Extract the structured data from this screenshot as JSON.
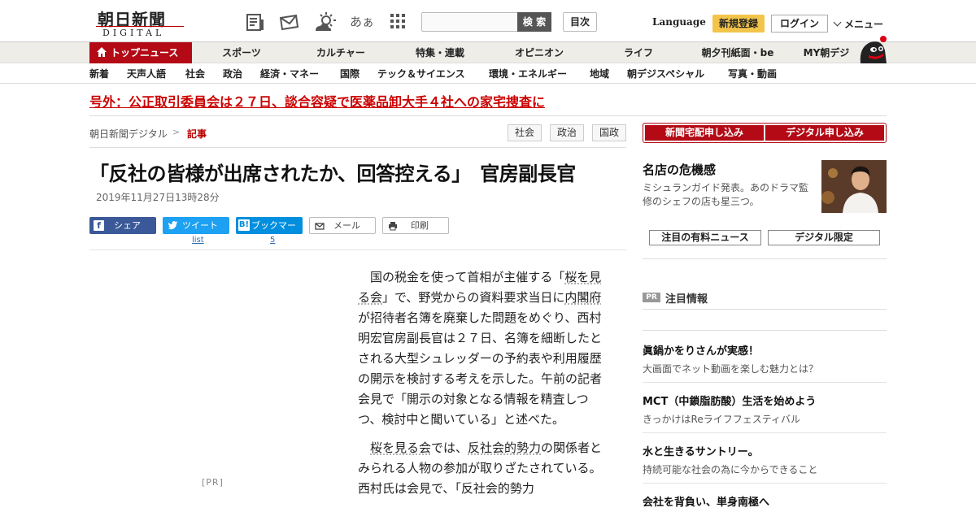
{
  "header": {
    "logo_jp": "朝日新聞",
    "logo_en": "DIGITAL",
    "search_placeholder": "",
    "search_button": "検 索",
    "contents_button": "目次",
    "language": "Language",
    "register": "新規登録",
    "login": "ログイン",
    "menu": "メニュー",
    "icons": [
      "paper-icon",
      "mail-icon",
      "weather-icon",
      "font-size-icon",
      "grid-icon"
    ],
    "font_size_glyph": "あぁ"
  },
  "nav_primary": {
    "top_news": "トップニュース",
    "items": [
      "スポーツ",
      "カルチャー",
      "特集・連載",
      "オピニオン",
      "ライフ",
      "朝夕刊紙面・be",
      "MY朝デジ"
    ]
  },
  "nav_secondary": {
    "items": [
      "新着",
      "天声人語",
      "社会",
      "政治",
      "経済・マネー",
      "国際",
      "テック＆サイエンス",
      "環境・エネルギー",
      "地域",
      "朝デジスペシャル",
      "写真・動画"
    ]
  },
  "breaking": "号外：公正取引委員会は２７日、談合容疑で医薬品卸大手４社への家宅捜査に",
  "breadcrumb": {
    "home": "朝日新聞デジタル",
    "separator": ">",
    "current": "記事"
  },
  "tags": [
    "社会",
    "政治",
    "国政"
  ],
  "article": {
    "headline": "「反社の皆様が出席されたか、回答控える」　官房副長官",
    "date": "2019年11月27日13時28分",
    "share": {
      "facebook": "シェア",
      "twitter": "ツイート",
      "twitter_sub": "list",
      "hatena": "ブックマーク",
      "hatena_sub": "5",
      "mail": "メール",
      "print": "印刷"
    },
    "pr_label": "[PR]",
    "p1": {
      "pre": "国の税金を使って首相が主催する「",
      "kw1": "桜を見る会",
      "mid1": "」で、野党からの資料要求当日に",
      "kw2": "内閣府",
      "rest": "が招待者名簿を廃棄した問題をめぐり、西村明宏官房副長官は２７日、名簿を細断したとされる大型シュレッダーの予約表や利用履歴の開示を検討する考えを示した。午前の記者会見で「開示の対象となる情報を精査しつつ、検討中と聞いている」と述べた。"
    },
    "p2": {
      "kw1": "桜を見る会",
      "mid1": "では、",
      "kw2": "反社会的勢力",
      "rest": "の関係者とみられる人物の参加が取りざたされている。西村氏は会見で、「反社会的勢力"
    }
  },
  "sidebar": {
    "subscribe_paper": "新聞宅配申し込み",
    "subscribe_digital": "デジタル申し込み",
    "promo_title": "名店の危機感",
    "promo_text": "ミシュランガイド発表。あのドラマ監修のシェフの店も星三つ。",
    "tab_paid": "注目の有料ニュース",
    "tab_digital": "デジタル限定",
    "pr_badge": "PR",
    "notice_title": "注目情報",
    "ads": [
      {
        "title": "眞鍋かをりさんが実感！",
        "desc": "大画面でネット動画を楽しむ魅力とは？"
      },
      {
        "title": "MCT（中鎖脂肪酸）生活を始めよう",
        "desc": "きっかけはReライフフェスティバル"
      },
      {
        "title": "水と生きるサントリー。",
        "desc": "持続可能な社会の為に今からできること"
      },
      {
        "title": "会社を背負い、単身南極へ",
        "desc": ""
      }
    ]
  },
  "colors": {
    "brand_red": "#b30a15",
    "register_yellow": "#f3c44a",
    "twitter_blue": "#1da1f2",
    "facebook_blue": "#3b5998",
    "hatena_blue": "#008fde"
  }
}
